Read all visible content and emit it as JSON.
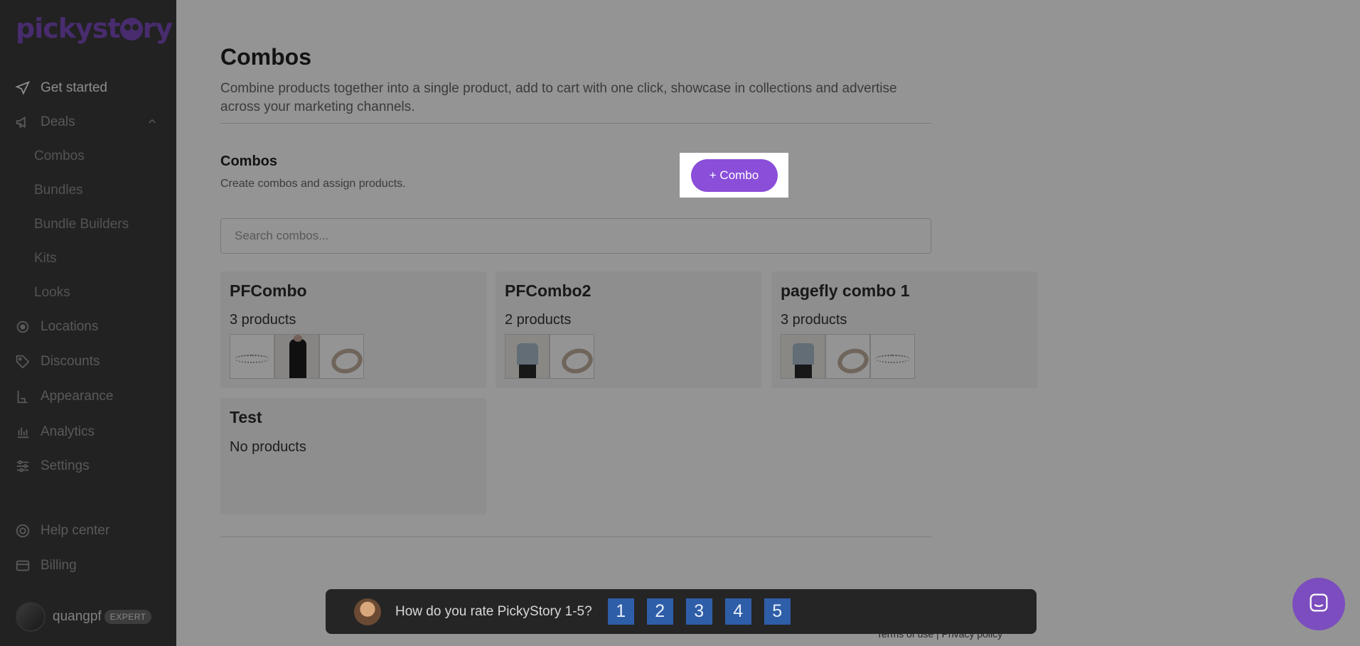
{
  "brand": {
    "name": "pickystory",
    "name_pre": "pickyst",
    "name_post": "ry",
    "accent": "#8a4ed9"
  },
  "sidebar": {
    "items": [
      {
        "label": "Get started",
        "icon": "send-arrow-icon"
      },
      {
        "label": "Deals",
        "icon": "megaphone-icon"
      },
      {
        "label": "Locations",
        "icon": "location-pin-icon"
      },
      {
        "label": "Discounts",
        "icon": "tag-icon"
      },
      {
        "label": "Appearance",
        "icon": "paint-roller-icon"
      },
      {
        "label": "Analytics",
        "icon": "bar-chart-icon"
      },
      {
        "label": "Settings",
        "icon": "sliders-icon"
      },
      {
        "label": "Help center",
        "icon": "lifebuoy-icon"
      },
      {
        "label": "Billing",
        "icon": "credit-card-icon"
      }
    ],
    "deals_sub": [
      "Combos",
      "Bundles",
      "Bundle Builders",
      "Kits",
      "Looks"
    ],
    "user": {
      "name": "quangpf",
      "badge": "EXPERT"
    }
  },
  "main": {
    "title": "Combos",
    "description": "Combine products together into a single product, add to cart with one click, showcase in collections and advertise across your marketing channels.",
    "section_title": "Combos",
    "section_desc": "Create combos and assign products.",
    "add_button": "+ Combo",
    "search_placeholder": "Search combos...",
    "cards": [
      {
        "title": "PFCombo",
        "count": "3 products"
      },
      {
        "title": "PFCombo2",
        "count": "2 products"
      },
      {
        "title": "pagefly combo 1",
        "count": "3 products"
      },
      {
        "title": "Test",
        "count": "No products"
      }
    ],
    "footer": {
      "terms": "Terms of use",
      "sep": "|",
      "privacy": "Privacy policy"
    }
  },
  "rating": {
    "question": "How do you rate PickyStory 1-5?",
    "options": [
      "1",
      "2",
      "3",
      "4",
      "5"
    ]
  }
}
